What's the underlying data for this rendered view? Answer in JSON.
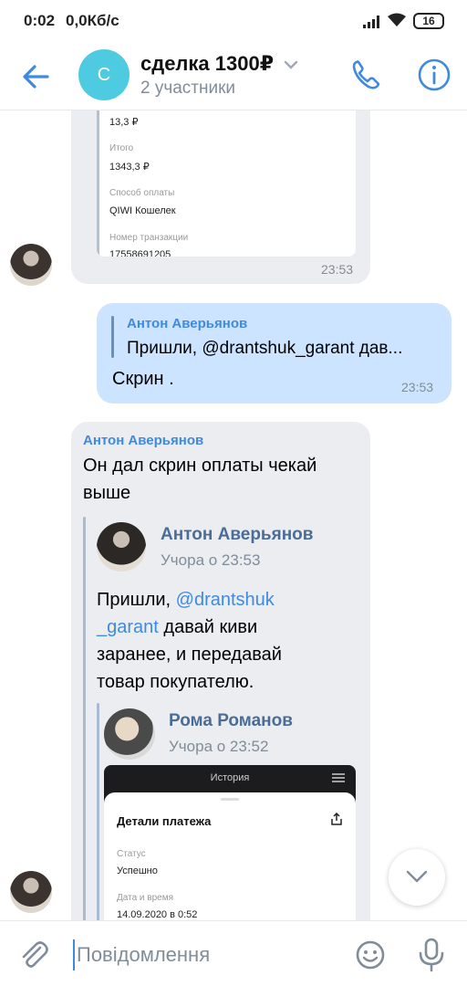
{
  "status": {
    "time": "0:02",
    "speed": "0,0Кб/с",
    "battery": "16"
  },
  "header": {
    "avatar_letter": "С",
    "title": "сделка 1300₽",
    "subtitle": "2 участники"
  },
  "receipt": {
    "amount": "13,3 ₽",
    "total_label": "Итого",
    "total_value": "1343,3 ₽",
    "method_label": "Способ оплаты",
    "method_value": "QIWI Кошелек",
    "txn_label": "Номер транзакции",
    "txn_value": "17558691205",
    "time": "23:53"
  },
  "outgoing": {
    "reply_name": "Антон Аверьянов",
    "reply_text": "Пришли, @drantshuk_garant дав...",
    "text": "Скрин .",
    "time": "23:53"
  },
  "incoming": {
    "sender": "Антон Аверьянов",
    "text_line1": "Он дал скрин оплаты чекай",
    "text_line2": "выше",
    "fwd1": {
      "name": "Антон Аверьянов",
      "date": "Учора о 23:53",
      "line1_pre": "Пришли, ",
      "line1_mention": "@drantshuk",
      "line2_mention": "_garant",
      "line2_post": " давай киви",
      "line3": "заранее, и передавай",
      "line4": "товар покупателю."
    },
    "fwd2": {
      "name": "Рома Романов",
      "date": "Учора о 23:52"
    },
    "shot": {
      "title": "История",
      "heading": "Детали платежа",
      "status_label": "Статус",
      "status_value": "Успешно",
      "date_label": "Дата и время",
      "date_value": "14.09.2020 в 0:52"
    }
  },
  "composer": {
    "placeholder": "Повідомлення"
  },
  "colors": {
    "accent": "#3f8ae0",
    "incoming_bubble": "#ebedf0",
    "outgoing_bubble": "#cce4ff"
  }
}
